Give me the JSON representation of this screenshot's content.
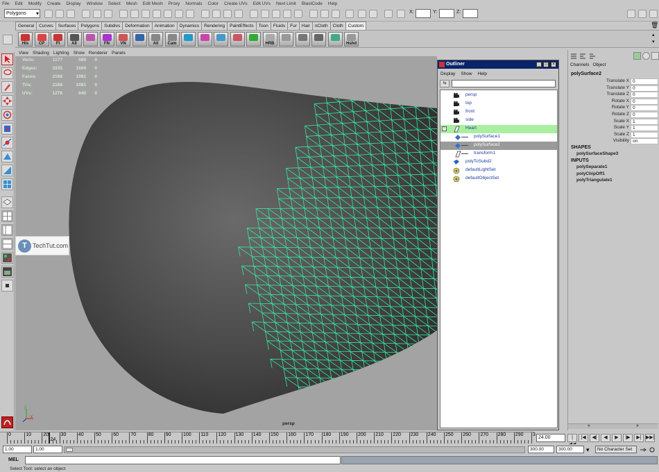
{
  "menubar": [
    "File",
    "Edit",
    "Modify",
    "Create",
    "Display",
    "Window",
    "Select",
    "Mesh",
    "Edit Mesh",
    "Proxy",
    "Normals",
    "Color",
    "Create UVs",
    "Edit UVs",
    "Next Limit",
    "BlastCode",
    "Help"
  ],
  "statusline": {
    "mode": "Polygons",
    "x_label": "X:",
    "y_label": "Y:",
    "z_label": "Z:"
  },
  "shelf": {
    "tabs": [
      "General",
      "Curves",
      "Surfaces",
      "Polygons",
      "Subdivs",
      "Deformation",
      "Animation",
      "Dynamics",
      "Rendering",
      "PaintEffects",
      "Toon",
      "Fluids",
      "Fur",
      "Hair",
      "nCloth",
      "Cloth",
      "Custom"
    ],
    "active_tab": "Custom",
    "icons": [
      {
        "label": "His",
        "color": "#c33"
      },
      {
        "label": "CP",
        "color": "#d44"
      },
      {
        "label": "FI",
        "color": "#c33"
      },
      {
        "label": "All",
        "color": "#555"
      },
      {
        "label": "",
        "color": "#b5a"
      },
      {
        "label": "FN",
        "color": "#a3c"
      },
      {
        "label": "VN",
        "color": "#c55"
      },
      {
        "label": "",
        "color": "#36a"
      },
      {
        "label": "All",
        "color": "#888"
      },
      {
        "label": "Cam",
        "color": "#888"
      },
      {
        "label": "",
        "color": "#29c"
      },
      {
        "label": "",
        "color": "#c4a"
      },
      {
        "label": "",
        "color": "#49c"
      },
      {
        "label": "",
        "color": "#c56"
      },
      {
        "label": "",
        "color": "#3a3"
      },
      {
        "label": "HRB",
        "color": "#aaa"
      },
      {
        "label": "",
        "color": "#999"
      },
      {
        "label": "",
        "color": "#777"
      },
      {
        "label": "",
        "color": "#666"
      },
      {
        "label": "",
        "color": "#4a8"
      },
      {
        "label": "Hshd",
        "color": "#999"
      }
    ]
  },
  "panel_menu": [
    "View",
    "Shading",
    "Lighting",
    "Show",
    "Renderer",
    "Panels"
  ],
  "hud": [
    [
      "Verts:",
      "1177",
      "589",
      "0"
    ],
    [
      "Edges:",
      "3335",
      "1669",
      "0"
    ],
    [
      "Faces:",
      "2168",
      "1081",
      "0"
    ],
    [
      "Tris:",
      "2168",
      "1081",
      "0"
    ],
    [
      "UVs:",
      "1278",
      "640",
      "0"
    ]
  ],
  "viewport": {
    "camera": "persp"
  },
  "watermark": {
    "logo": "T",
    "text": "TechTut.com"
  },
  "outliner": {
    "title": "Outliner",
    "menu": [
      "Display",
      "Show",
      "Help"
    ],
    "items": [
      {
        "name": "persp",
        "indent": 0,
        "icon": "camera-icon",
        "state": "none"
      },
      {
        "name": "top",
        "indent": 0,
        "icon": "camera-icon",
        "state": "none"
      },
      {
        "name": "front",
        "indent": 0,
        "icon": "camera-icon",
        "state": "none"
      },
      {
        "name": "side",
        "indent": 0,
        "icon": "camera-icon",
        "state": "none"
      },
      {
        "name": "Heart",
        "indent": 0,
        "icon": "transform-icon",
        "state": "selected"
      },
      {
        "name": "polySurface1",
        "indent": 1,
        "icon": "mesh-icon",
        "state": "none"
      },
      {
        "name": "polySurface2",
        "indent": 1,
        "icon": "mesh-icon",
        "state": "highlighted"
      },
      {
        "name": "transform1",
        "indent": 1,
        "icon": "transform-icon",
        "state": "none"
      },
      {
        "name": "polyToSubd2",
        "indent": 0,
        "icon": "subd-icon",
        "state": "none"
      },
      {
        "name": "defaultLightSet",
        "indent": 0,
        "icon": "set-icon",
        "state": "none"
      },
      {
        "name": "defaultObjectSet",
        "indent": 0,
        "icon": "set-icon",
        "state": "none"
      }
    ]
  },
  "channelbox": {
    "tabs": [
      "Channels",
      "Object"
    ],
    "object": "polySurface2",
    "attributes": [
      {
        "name": "Translate X",
        "value": "0"
      },
      {
        "name": "Translate Y",
        "value": "0"
      },
      {
        "name": "Translate Z",
        "value": "0"
      },
      {
        "name": "Rotate X",
        "value": "0"
      },
      {
        "name": "Rotate Y",
        "value": "0"
      },
      {
        "name": "Rotate Z",
        "value": "0"
      },
      {
        "name": "Scale X",
        "value": "1"
      },
      {
        "name": "Scale Y",
        "value": "1"
      },
      {
        "name": "Scale Z",
        "value": "1"
      },
      {
        "name": "Visibility",
        "value": "on"
      }
    ],
    "shapes_header": "SHAPES",
    "shapes": [
      "polySurfaceShape3"
    ],
    "inputs_header": "INPUTS",
    "inputs": [
      "polySeparate1",
      "polyChipOff1",
      "polyTriangulate1"
    ]
  },
  "timeline": {
    "ticks": [
      "0",
      "10",
      "20",
      "30",
      "40",
      "50",
      "60",
      "70",
      "80",
      "90",
      "100",
      "110",
      "120",
      "130",
      "140",
      "150",
      "160",
      "170",
      "180",
      "190",
      "200",
      "210",
      "220",
      "230",
      "240",
      "250",
      "260",
      "270",
      "280",
      "290",
      "3"
    ],
    "current_marker": "24",
    "current_frame": "24.00",
    "playback_buttons": [
      "|◀◀",
      "|◀",
      "◀|",
      "◀",
      "▶",
      "|▶",
      "▶|",
      "▶▶|"
    ]
  },
  "range": {
    "start": "1.00",
    "inner_start": "1.00",
    "inner_end": "300.00",
    "end": "300.00",
    "character_set": "No Character Set"
  },
  "command_line": {
    "label": "MEL"
  },
  "help_line": "Select Tool: select an object",
  "colors": {
    "wireframe": "#35e8a0",
    "viewport_bg": "#a3a3a3",
    "hud_text": "#d4e8d0",
    "outliner_selected": "#a8f0a0",
    "title_bar": "#0a246a"
  }
}
